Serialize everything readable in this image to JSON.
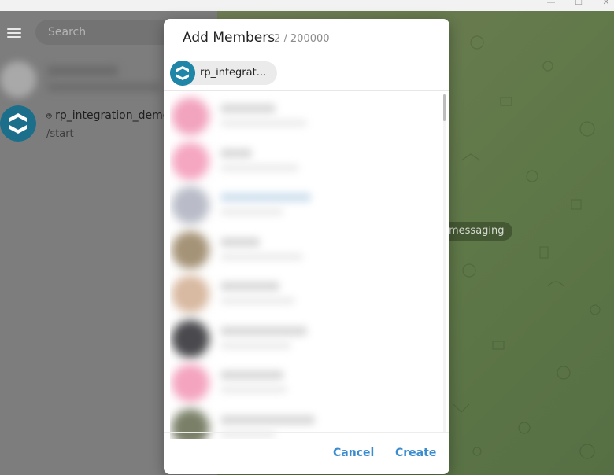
{
  "window": {
    "minimize_glyph": "—",
    "maximize_glyph": "☐",
    "close_glyph": "✕"
  },
  "sidebar": {
    "search_placeholder": "Search",
    "chats": [
      {
        "title": "",
        "subtitle": "",
        "avatar_color": "#d9d9d9",
        "blurred": true
      },
      {
        "title": "rp_integration_demo",
        "subtitle": "/start",
        "avatar_color": "#1f86a8",
        "bot_icon": "bot-icon"
      }
    ]
  },
  "chat_area": {
    "service_message": "messaging"
  },
  "modal": {
    "title": "Add Members",
    "count": "2 / 200000",
    "selected": [
      {
        "label": "rp_integrat...",
        "avatar_color": "#1f86a8"
      }
    ],
    "contacts": [
      {
        "avatar_color": "#f2a3bd",
        "blurred": true
      },
      {
        "avatar_color": "#f5a6c0",
        "blurred": true
      },
      {
        "avatar_color": "#b9bcc8",
        "blurred": true
      },
      {
        "avatar_color": "#a59377",
        "blurred": true
      },
      {
        "avatar_color": "#d8b9a1",
        "blurred": true
      },
      {
        "avatar_color": "#4a4a4e",
        "blurred": true
      },
      {
        "avatar_color": "#f4a4bf",
        "blurred": true
      },
      {
        "avatar_color": "#7a8068",
        "blurred": true
      }
    ],
    "cancel_label": "Cancel",
    "create_label": "Create"
  },
  "colors": {
    "accent": "#3b8ccd",
    "bot_avatar": "#1f86a8",
    "overlay_left": "#7d7d7d",
    "chat_bg": "#5f7848"
  }
}
